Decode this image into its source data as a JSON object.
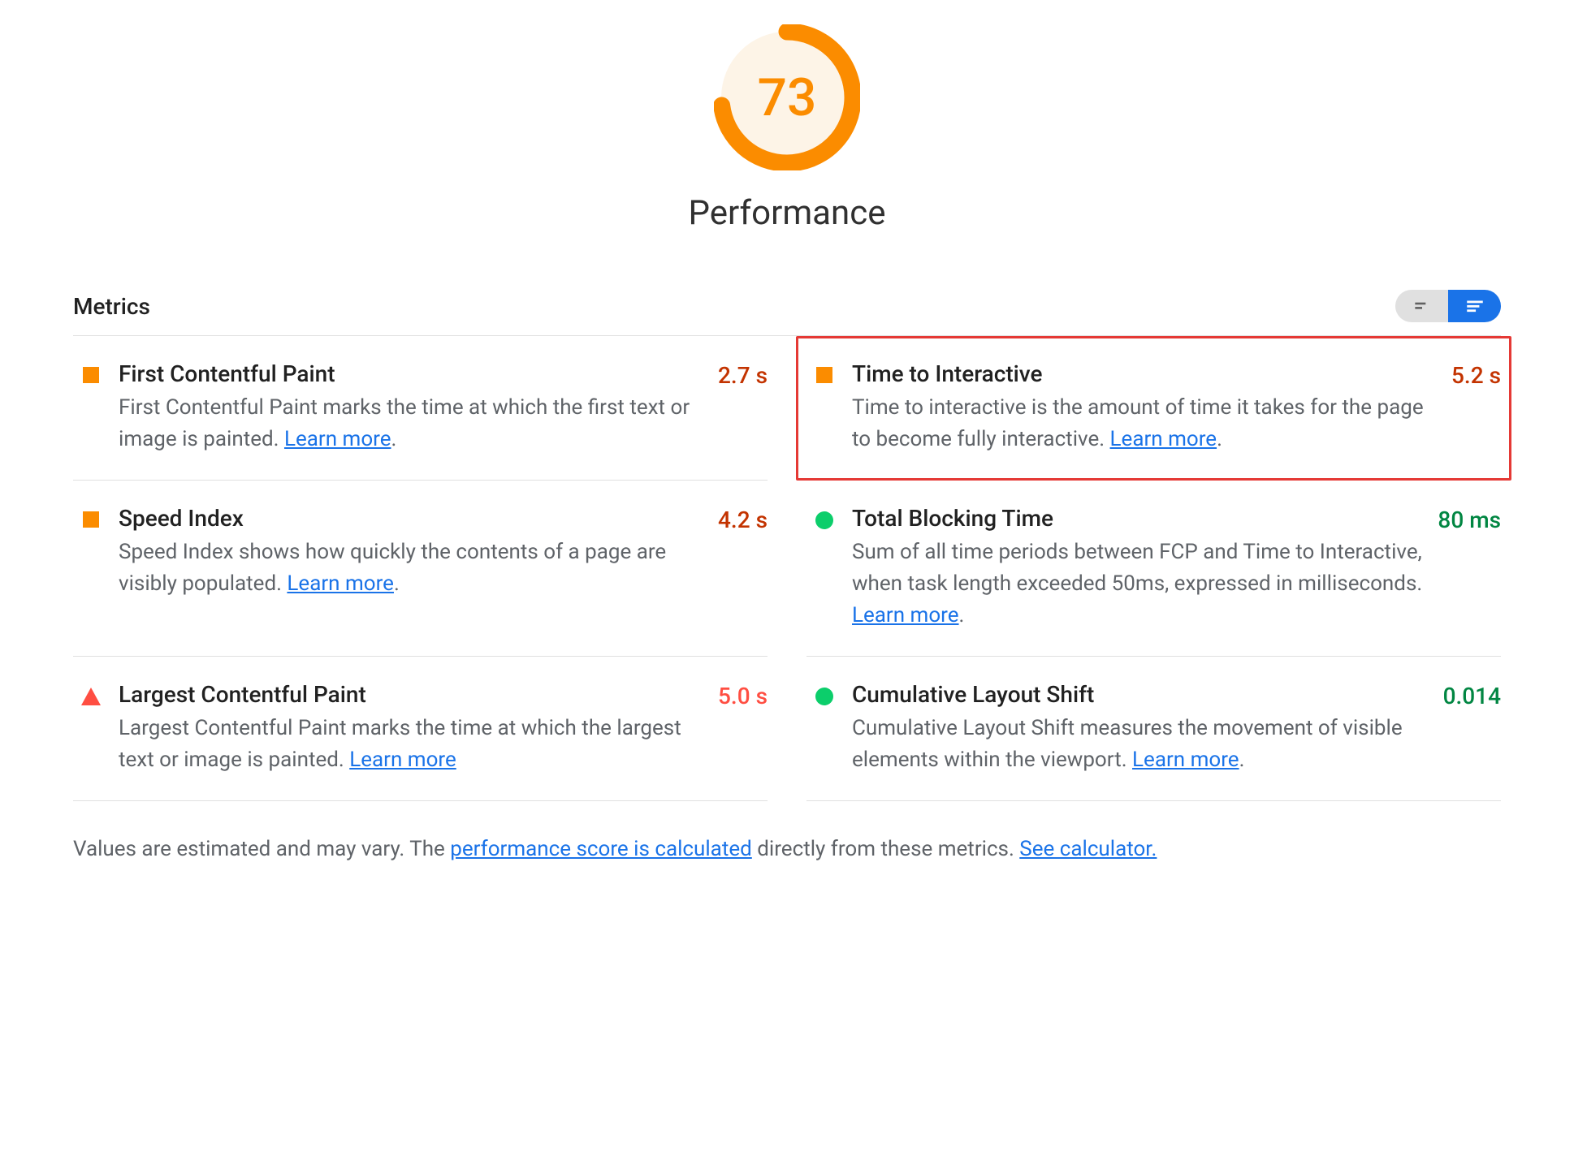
{
  "gauge": {
    "score": "73",
    "percent": 73,
    "label": "Performance"
  },
  "metrics_header": "Metrics",
  "learn_more": "Learn more",
  "metrics": [
    {
      "key": "fcp",
      "title": "First Contentful Paint",
      "desc_pre": "First Contentful Paint marks the time at which the first text or image is painted. ",
      "desc_post": ".",
      "value": "2.7 s",
      "icon": "square",
      "value_class": "val-orange",
      "highlighted": false
    },
    {
      "key": "tti",
      "title": "Time to Interactive",
      "desc_pre": "Time to interactive is the amount of time it takes for the page to become fully interactive. ",
      "desc_post": ".",
      "value": "5.2 s",
      "icon": "square",
      "value_class": "val-orange",
      "highlighted": true
    },
    {
      "key": "si",
      "title": "Speed Index",
      "desc_pre": "Speed Index shows how quickly the contents of a page are visibly populated. ",
      "desc_post": ".",
      "value": "4.2 s",
      "icon": "square",
      "value_class": "val-orange",
      "highlighted": false
    },
    {
      "key": "tbt",
      "title": "Total Blocking Time",
      "desc_pre": "Sum of all time periods between FCP and Time to Interactive, when task length exceeded 50ms, expressed in milliseconds. ",
      "desc_post": ".",
      "value": "80 ms",
      "icon": "circle",
      "value_class": "val-green",
      "highlighted": false
    },
    {
      "key": "lcp",
      "title": "Largest Contentful Paint",
      "desc_pre": "Largest Contentful Paint marks the time at which the largest text or image is painted. ",
      "desc_post": "",
      "value": "5.0 s",
      "icon": "triangle",
      "value_class": "val-red",
      "highlighted": false
    },
    {
      "key": "cls",
      "title": "Cumulative Layout Shift",
      "desc_pre": "Cumulative Layout Shift measures the movement of visible elements within the viewport. ",
      "desc_post": ".",
      "value": "0.014",
      "icon": "circle",
      "value_class": "val-green",
      "highlighted": false
    }
  ],
  "footer": {
    "pre": "Values are estimated and may vary. The ",
    "link1": "performance score is calculated",
    "mid": " directly from these metrics. ",
    "link2": "See calculator."
  }
}
